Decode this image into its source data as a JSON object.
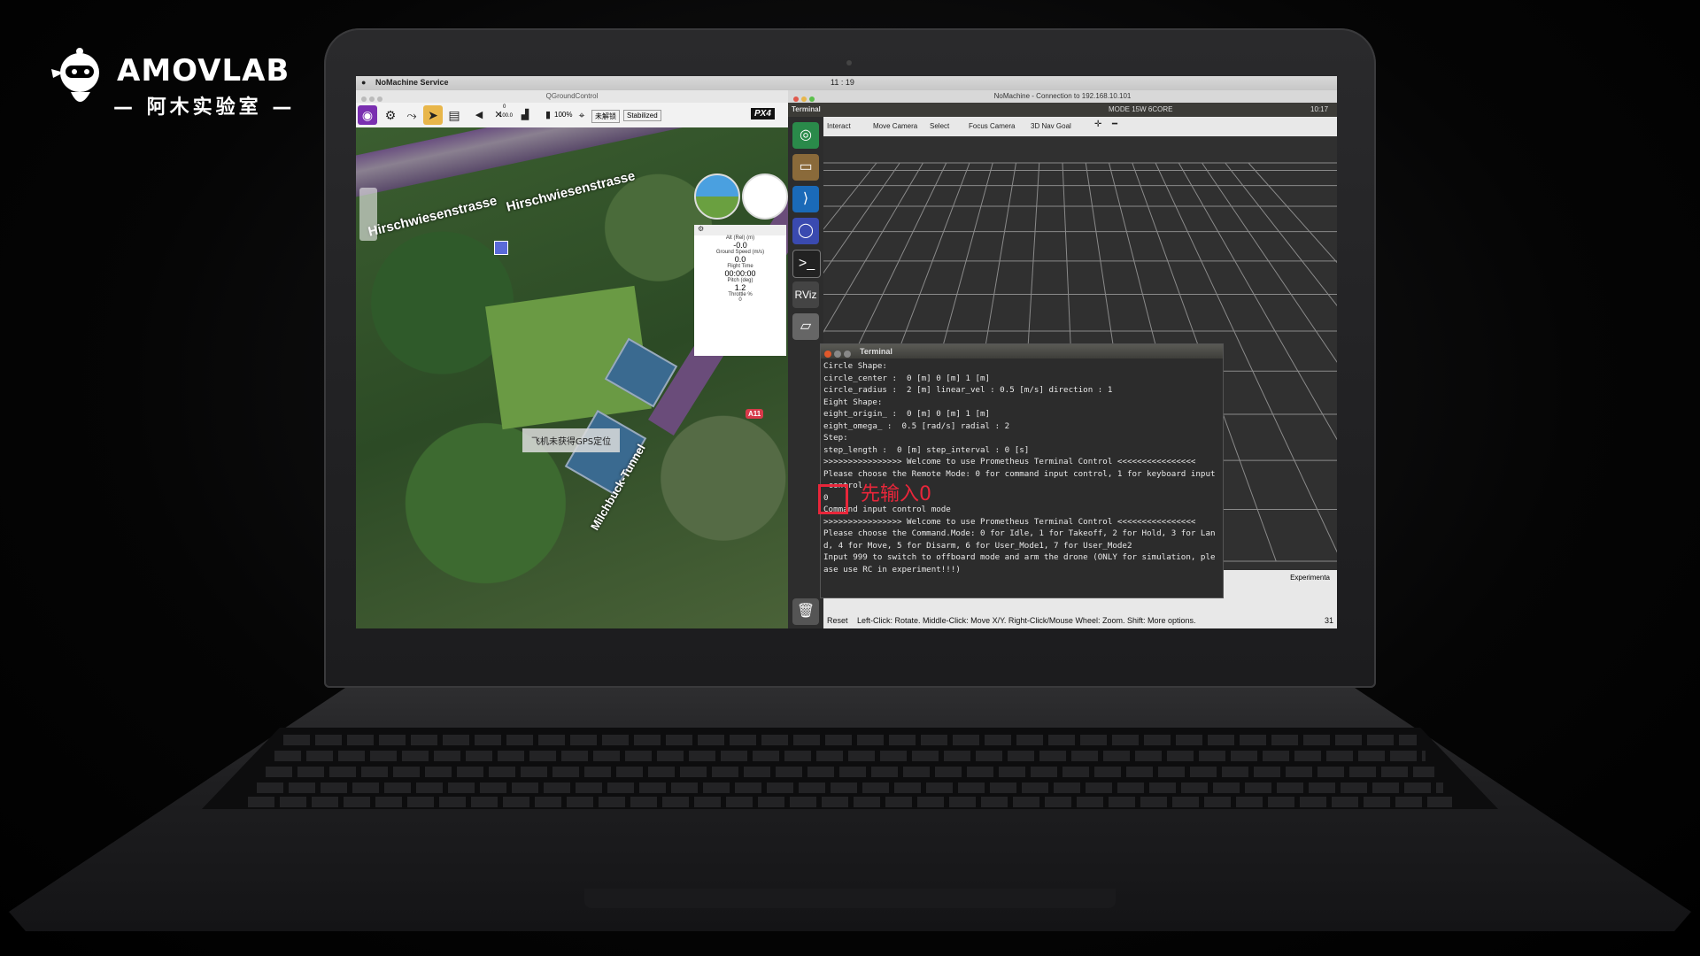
{
  "branding": {
    "logo_text": "AMOVLAB",
    "logo_sub": "— 阿木实验室 —"
  },
  "mac_menubar": {
    "app": "NoMachine Service",
    "clock": "11 : 19"
  },
  "qgc": {
    "window_title": "QGroundControl",
    "toolbar": {
      "battery": "100%",
      "arm_state": "未解锁",
      "flight_mode": "Stabilized",
      "px4_badge": "PX4",
      "gps_count": "0",
      "hdop": "100.0"
    },
    "map": {
      "street_1": "Hirschwiesenstrasse",
      "street_2": "Hirschwiesenstrasse",
      "tunnel": "Milchbuck-Tunnel",
      "road_sign": "A11",
      "gps_message": "飞机未获得GPS定位"
    },
    "telemetry": {
      "alt_label": "Alt (Rel) (m)",
      "alt_value": "-0.0",
      "gs_label": "Ground Speed (m/s)",
      "gs_value": "0.0",
      "ft_label": "Flight Time",
      "ft_value": "00:00:00",
      "pitch_label": "Pitch (deg)",
      "pitch_value": "1.2",
      "throttle_label": "Throttle %",
      "throttle_value": "0"
    }
  },
  "nomachine": {
    "window_title": "NoMachine - Connection to 192.168.10.101",
    "ubuntu_bar": {
      "app": "Terminal",
      "gpu_mode": "MODE 15W 6CORE",
      "time": "10:17"
    },
    "rviz": {
      "tools": [
        "Interact",
        "Move Camera",
        "Select",
        "Focus Camera",
        "3D Nav Goal"
      ],
      "reset_label": "Reset",
      "hint": "Left-Click: Rotate. Middle-Click: Move X/Y. Right-Click/Mouse Wheel: Zoom. Shift: More options.",
      "experimental_label": "Experimenta",
      "fps": "31"
    },
    "terminal": {
      "title": "Terminal",
      "lines": [
        "Circle Shape:",
        "circle_center :  0 [m] 0 [m] 1 [m]",
        "circle_radius :  2 [m] linear_vel : 0.5 [m/s] direction : 1",
        "Eight Shape:",
        "eight_origin_ :  0 [m] 0 [m] 1 [m]",
        "eight_omega_ :  0.5 [rad/s] radial : 2",
        "Step:",
        "step_length :  0 [m] step_interval : 0 [s]",
        ">>>>>>>>>>>>>>>> Welcome to use Prometheus Terminal Control <<<<<<<<<<<<<<<<",
        "Please choose the Remote Mode: 0 for command input control, 1 for keyboard input",
        " control",
        "0",
        "Command input control mode",
        ">>>>>>>>>>>>>>>> Welcome to use Prometheus Terminal Control <<<<<<<<<<<<<<<<",
        "Please choose the Command.Mode: 0 for Idle, 1 for Takeoff, 2 for Hold, 3 for Lan",
        "d, 4 for Move, 5 for Disarm, 6 for User_Mode1, 7 for User_Mode2",
        "Input 999 to switch to offboard mode and arm the drone (ONLY for simulation, ple",
        "ase use RC in experiment!!!)"
      ]
    }
  },
  "annotation": {
    "text": "先输入0",
    "color": "#e8263a"
  }
}
